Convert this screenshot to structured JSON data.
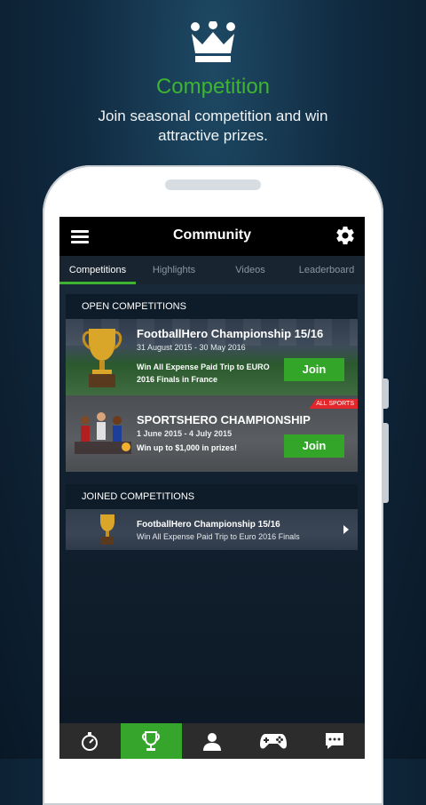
{
  "promo": {
    "title": "Competition",
    "subtitle": "Join seasonal competition and win attractive prizes."
  },
  "app": {
    "title": "Community",
    "tabs": [
      "Competitions",
      "Highlights",
      "Videos",
      "Leaderboard"
    ],
    "active_tab": "Competitions"
  },
  "open_competitions": {
    "header": "OPEN COMPETITIONS",
    "items": [
      {
        "title": "FootballHero Championship 15/16",
        "dates": "31 August 2015 - 30 May 2016",
        "prize": "Win All Expense Paid Trip to EURO 2016 Finals in France",
        "button": "Join",
        "icon": "trophy-icon"
      },
      {
        "title": "SPORTSHERO CHAMPIONSHIP",
        "dates": "1 June 2015 - 4 July 2015",
        "prize": "Win up to $1,000 in prizes!",
        "button": "Join",
        "tag": "ALL SPORTS",
        "icon": "athletes-icon"
      }
    ]
  },
  "joined_competitions": {
    "header": "JOINED COMPETITIONS",
    "items": [
      {
        "title": "FootballHero Championship 15/16",
        "description": "Win All Expense Paid Trip to Euro 2016 Finals",
        "icon": "trophy-icon"
      }
    ]
  },
  "bottom_nav": [
    {
      "icon": "stopwatch-icon",
      "active": false
    },
    {
      "icon": "trophy-icon",
      "active": true
    },
    {
      "icon": "person-icon",
      "active": false
    },
    {
      "icon": "gamepad-icon",
      "active": false
    },
    {
      "icon": "chat-icon",
      "active": false
    }
  ],
  "colors": {
    "accent": "#3fb431",
    "button": "#33a62a",
    "tag": "#e3262b",
    "appbar": "#000000"
  }
}
